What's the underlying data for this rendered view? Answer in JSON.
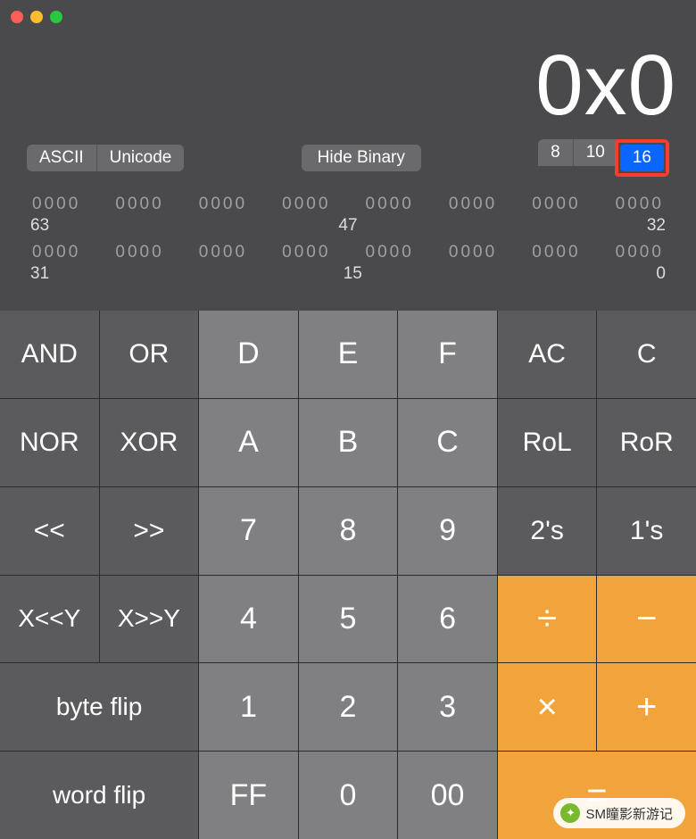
{
  "display": {
    "value": "0x0"
  },
  "controls": {
    "ascii": "ASCII",
    "unicode": "Unicode",
    "hide_binary": "Hide Binary",
    "base8": "8",
    "base10": "10",
    "base16": "16"
  },
  "binary": {
    "groups_hi": [
      "0000",
      "0000",
      "0000",
      "0000",
      "0000",
      "0000",
      "0000",
      "0000"
    ],
    "labels_hi": {
      "left": "63",
      "mid": "47",
      "right": "32"
    },
    "groups_lo": [
      "0000",
      "0000",
      "0000",
      "0000",
      "0000",
      "0000",
      "0000",
      "0000"
    ],
    "labels_lo": {
      "left": "31",
      "mid": "15",
      "right": "0"
    }
  },
  "keys": {
    "r0": [
      "AND",
      "OR",
      "D",
      "E",
      "F",
      "AC",
      "C"
    ],
    "r1": [
      "NOR",
      "XOR",
      "A",
      "B",
      "C",
      "RoL",
      "RoR"
    ],
    "r2": [
      "<<",
      ">>",
      "7",
      "8",
      "9",
      "2's",
      "1's"
    ],
    "r3": [
      "X<<Y",
      "X>>Y",
      "4",
      "5",
      "6",
      "÷",
      "−"
    ],
    "r4": [
      "byte flip",
      "1",
      "2",
      "3",
      "×",
      "+"
    ],
    "r5": [
      "word flip",
      "FF",
      "0",
      "00",
      "="
    ]
  },
  "watermark": {
    "text": "SM瞳影新游记"
  }
}
